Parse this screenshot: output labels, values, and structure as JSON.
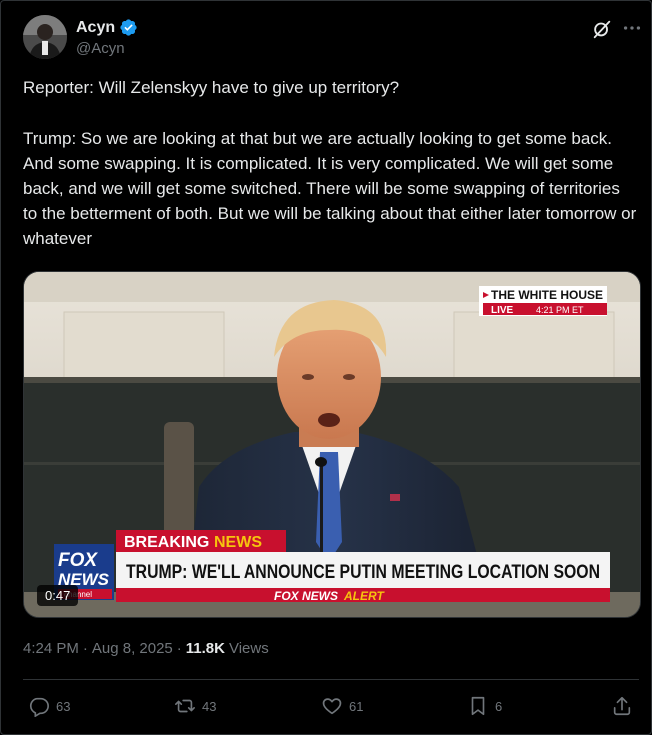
{
  "author": {
    "name": "Acyn",
    "handle": "@Acyn",
    "verified": true
  },
  "tweet": {
    "paragraph_1": "Reporter: Will Zelenskyy have to give up territory?",
    "paragraph_2": "Trump: So we are looking at that but we are actually looking to get some back. And some swapping. It is complicated. It is very complicated. We will get some back, and we will get some switched. There will be some swapping of territories to the betterment of both. But we will be talking about that either later tomorrow or whatever"
  },
  "video": {
    "duration": "0:47",
    "overlay": {
      "bug_line": "THE WHITE HOUSE",
      "live_label": "LIVE",
      "live_time": "4:21 PM ET",
      "breaking_label": "BREAKING",
      "news_label": "NEWS",
      "headline": "TRUMP: WE'LL ANNOUNCE PUTIN MEETING LOCATION SOON",
      "alert_brand": "FOX NEWS",
      "alert_word": "ALERT",
      "logo_top": "FOX",
      "logo_bottom": "NEWS",
      "logo_sub": "channel"
    }
  },
  "meta": {
    "time": "4:24 PM",
    "sep": "·",
    "date": "Aug 8, 2025",
    "sep2": "·",
    "views_count": "11.8K",
    "views_label": "Views"
  },
  "actions": {
    "replies": "63",
    "reposts": "43",
    "likes": "61",
    "bookmarks": "6"
  },
  "icons": {
    "verified": "verified-badge-icon",
    "grok": "grok-icon",
    "more": "more-icon",
    "reply": "reply-icon",
    "repost": "repost-icon",
    "like": "heart-icon",
    "bookmark": "bookmark-icon",
    "share": "share-icon"
  },
  "colors": {
    "background": "#000000",
    "text": "#e7e9ea",
    "secondary_text": "#71767b",
    "verified_blue": "#1d9bf0",
    "fox_red": "#c8102e",
    "alert_yellow": "#f6c40e"
  }
}
